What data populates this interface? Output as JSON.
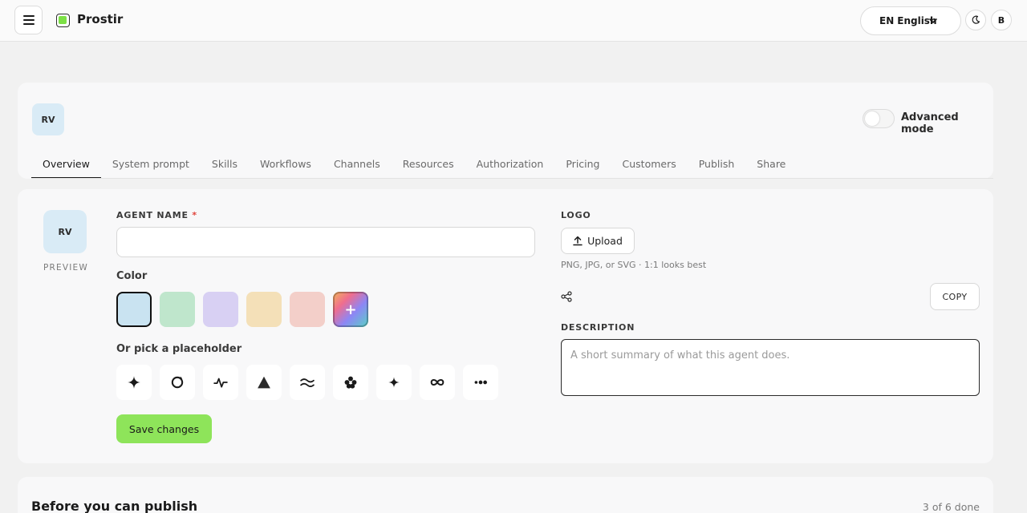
{
  "app": {
    "name": "Prostir"
  },
  "topbar": {
    "language_code": "EN",
    "language_label": "English",
    "user_initial": "B"
  },
  "agent": {
    "initials": "RV",
    "advanced_mode_label": "Advanced mode",
    "advanced_mode_on": false
  },
  "tabs": [
    {
      "label": "Overview",
      "active": true
    },
    {
      "label": "System prompt",
      "active": false
    },
    {
      "label": "Skills",
      "active": false
    },
    {
      "label": "Workflows",
      "active": false
    },
    {
      "label": "Channels",
      "active": false
    },
    {
      "label": "Resources",
      "active": false
    },
    {
      "label": "Authorization",
      "active": false
    },
    {
      "label": "Pricing",
      "active": false
    },
    {
      "label": "Customers",
      "active": false
    },
    {
      "label": "Publish",
      "active": false
    },
    {
      "label": "Share",
      "active": false
    }
  ],
  "form": {
    "preview_initials": "RV",
    "preview_label": "PREVIEW",
    "name_label": "AGENT NAME",
    "name_required_mark": "*",
    "name_value": "",
    "color_label": "Color",
    "colors": [
      "#c9e3f1",
      "#bfe6cc",
      "#d8d0f3",
      "#f4e0b8",
      "#f3cfc9"
    ],
    "selected_color": "#c9e3f1",
    "custom_color_symbol": "+",
    "placeholder_label": "Or pick a placeholder",
    "placeholders": [
      "sparkle",
      "circle-arrow",
      "pulse",
      "triangle",
      "waves",
      "flower",
      "star",
      "infinity",
      "dots"
    ],
    "save_label": "Save changes",
    "logo_label": "LOGO",
    "upload_label": "Upload",
    "logo_hint": "PNG, JPG, or SVG · 1:1 looks best",
    "copy_label": "COPY",
    "description_label": "DESCRIPTION",
    "description_placeholder": "A short summary of what this agent does.",
    "description_value": ""
  },
  "publish": {
    "title": "Before you can publish",
    "progress_text": "3 of 6 done"
  },
  "colors": {
    "accent": "#8ee45a",
    "brand_green": "#7ce045",
    "avatar_bg": "#d9ebf6"
  }
}
